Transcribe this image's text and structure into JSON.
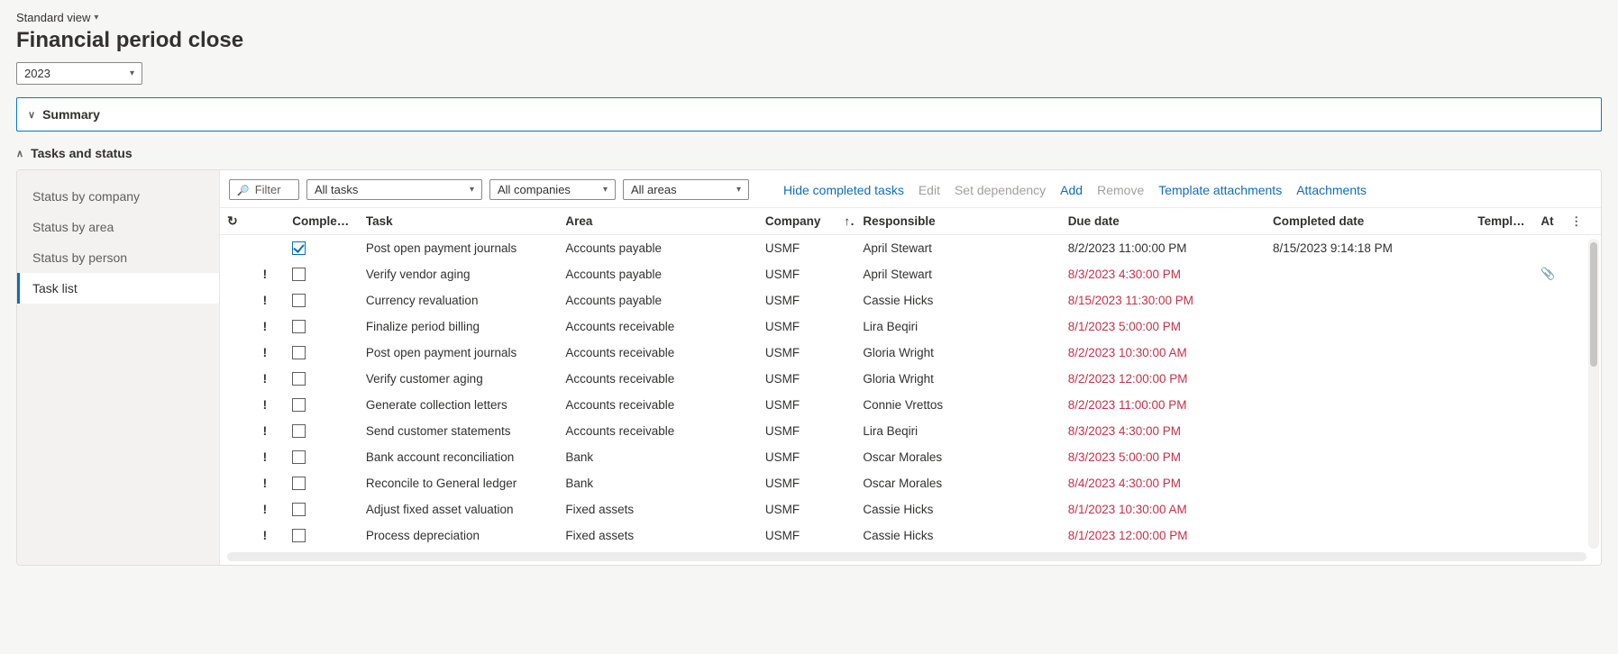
{
  "view_switch": "Standard view",
  "page_title": "Financial period close",
  "year_value": "2023",
  "summary_title": "Summary",
  "tasks_title": "Tasks and status",
  "sidebar": {
    "items": [
      {
        "label": "Status by company"
      },
      {
        "label": "Status by area"
      },
      {
        "label": "Status by person"
      },
      {
        "label": "Task list"
      }
    ],
    "active_index": 3
  },
  "toolbar": {
    "filter_placeholder": "Filter",
    "combo_tasks": "All tasks",
    "combo_companies": "All companies",
    "combo_areas": "All areas",
    "hide_completed": "Hide completed tasks",
    "edit": "Edit",
    "set_dependency": "Set dependency",
    "add": "Add",
    "remove": "Remove",
    "template_attachments": "Template attachments",
    "attachments": "Attachments"
  },
  "columns": {
    "completed": "Completed",
    "task": "Task",
    "area": "Area",
    "company": "Company",
    "responsible": "Responsible",
    "due_date": "Due date",
    "completed_date": "Completed date",
    "template": "Templat...",
    "at": "At"
  },
  "rows": [
    {
      "alert": false,
      "completed": true,
      "task": "Post open payment journals",
      "area": "Accounts payable",
      "company": "USMF",
      "responsible": "April Stewart",
      "due": "8/2/2023 11:00:00 PM",
      "overdue": false,
      "completed_date": "8/15/2023 9:14:18 PM",
      "attach": false
    },
    {
      "alert": true,
      "completed": false,
      "task": "Verify vendor aging",
      "area": "Accounts payable",
      "company": "USMF",
      "responsible": "April Stewart",
      "due": "8/3/2023 4:30:00 PM",
      "overdue": true,
      "completed_date": "",
      "attach": true
    },
    {
      "alert": true,
      "completed": false,
      "task": "Currency revaluation",
      "area": "Accounts payable",
      "company": "USMF",
      "responsible": "Cassie Hicks",
      "due": "8/15/2023 11:30:00 PM",
      "overdue": true,
      "completed_date": "",
      "attach": false
    },
    {
      "alert": true,
      "completed": false,
      "task": "Finalize period billing",
      "area": "Accounts receivable",
      "company": "USMF",
      "responsible": "Lira Beqiri",
      "due": "8/1/2023 5:00:00 PM",
      "overdue": true,
      "completed_date": "",
      "attach": false
    },
    {
      "alert": true,
      "completed": false,
      "task": "Post open payment journals",
      "area": "Accounts receivable",
      "company": "USMF",
      "responsible": "Gloria Wright",
      "due": "8/2/2023 10:30:00 AM",
      "overdue": true,
      "completed_date": "",
      "attach": false
    },
    {
      "alert": true,
      "completed": false,
      "task": "Verify customer aging",
      "area": "Accounts receivable",
      "company": "USMF",
      "responsible": "Gloria Wright",
      "due": "8/2/2023 12:00:00 PM",
      "overdue": true,
      "completed_date": "",
      "attach": false
    },
    {
      "alert": true,
      "completed": false,
      "task": "Generate collection letters",
      "area": "Accounts receivable",
      "company": "USMF",
      "responsible": "Connie Vrettos",
      "due": "8/2/2023 11:00:00 PM",
      "overdue": true,
      "completed_date": "",
      "attach": false
    },
    {
      "alert": true,
      "completed": false,
      "task": "Send customer statements",
      "area": "Accounts receivable",
      "company": "USMF",
      "responsible": "Lira Beqiri",
      "due": "8/3/2023 4:30:00 PM",
      "overdue": true,
      "completed_date": "",
      "attach": false
    },
    {
      "alert": true,
      "completed": false,
      "task": "Bank account reconciliation",
      "area": "Bank",
      "company": "USMF",
      "responsible": "Oscar Morales",
      "due": "8/3/2023 5:00:00 PM",
      "overdue": true,
      "completed_date": "",
      "attach": false
    },
    {
      "alert": true,
      "completed": false,
      "task": "Reconcile to General ledger",
      "area": "Bank",
      "company": "USMF",
      "responsible": "Oscar Morales",
      "due": "8/4/2023 4:30:00 PM",
      "overdue": true,
      "completed_date": "",
      "attach": false
    },
    {
      "alert": true,
      "completed": false,
      "task": "Adjust fixed asset valuation",
      "area": "Fixed assets",
      "company": "USMF",
      "responsible": "Cassie Hicks",
      "due": "8/1/2023 10:30:00 AM",
      "overdue": true,
      "completed_date": "",
      "attach": false
    },
    {
      "alert": true,
      "completed": false,
      "task": "Process depreciation",
      "area": "Fixed assets",
      "company": "USMF",
      "responsible": "Cassie Hicks",
      "due": "8/1/2023 12:00:00 PM",
      "overdue": true,
      "completed_date": "",
      "attach": false
    }
  ]
}
